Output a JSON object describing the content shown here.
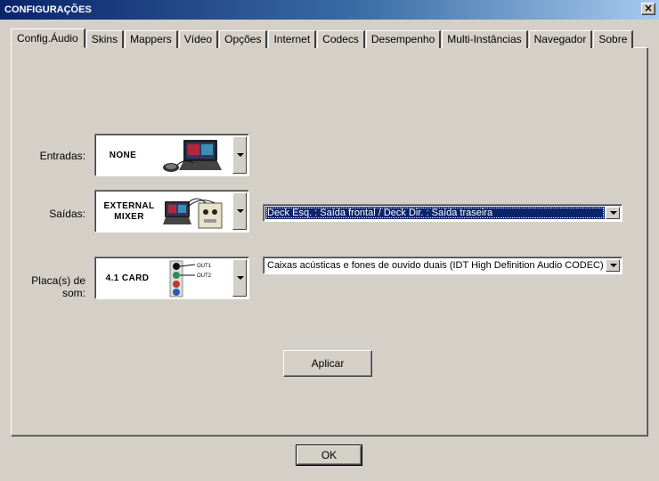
{
  "window": {
    "title": "CONFIGURAÇÕES",
    "close_label": "×"
  },
  "tabs": [
    {
      "label": "Config.Áudio",
      "active": true
    },
    {
      "label": "Skins"
    },
    {
      "label": "Mappers"
    },
    {
      "label": "Vídeo"
    },
    {
      "label": "Opções"
    },
    {
      "label": "Internet"
    },
    {
      "label": "Codecs"
    },
    {
      "label": "Desempenho"
    },
    {
      "label": "Multi-Instâncias"
    },
    {
      "label": "Navegador"
    },
    {
      "label": "Sobre"
    }
  ],
  "audio": {
    "inputs": {
      "label": "Entradas:",
      "value": "NONE",
      "icon": "laptop-with-turntable-icon"
    },
    "outputs": {
      "label": "Saídas:",
      "value_line1": "EXTERNAL",
      "value_line2": "MIXER",
      "icon": "laptop-with-external-mixer-icon",
      "routing": "Deck Esq. : Saída frontal / Deck Dir. : Saída traseira"
    },
    "soundcard": {
      "label": "Placa(s) de som:",
      "value": "4.1 CARD",
      "icon": "soundcard-jacks-icon",
      "out1": "OUT1",
      "out2": "OUT2",
      "device": "Caixas acústicas e fones de ouvido duais (IDT High Definition Audio CODEC)"
    },
    "apply_label": "Aplicar"
  },
  "footer": {
    "ok_label": "OK"
  },
  "colors": {
    "title_gradient_start": "#0a246a",
    "title_gradient_end": "#a6caf0",
    "face": "#d4d0c8",
    "selection": "#0a246a"
  }
}
